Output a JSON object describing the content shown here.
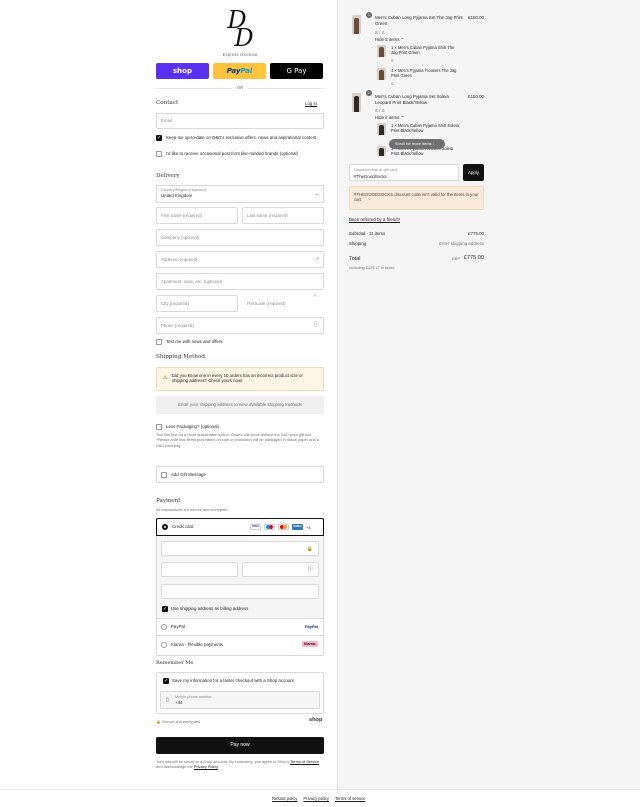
{
  "brand": {
    "logo_line1": "D",
    "logo_line2": "D"
  },
  "express": {
    "label": "Express checkout",
    "shop_label": "shop",
    "paypal_label_1": "Pay",
    "paypal_label_2": "Pal",
    "gpay_label": "G Pay",
    "or_label": "OR"
  },
  "contact": {
    "title": "Contact",
    "login_label": "Log in",
    "email_placeholder": "Email",
    "newsletter_label": "Keep me up-to-date on D&D's exclusive offers, news and aspirational content",
    "newsletter_checked": true,
    "post_label": "I'd like to receive occasional post from like-minded brands (optional)",
    "post_checked": false
  },
  "delivery": {
    "title": "Delivery",
    "country_label": "Country/Region (required)",
    "country_value": "United Kingdom",
    "first_name": "First name (required)",
    "last_name": "Last name (required)",
    "company": "Company (optional)",
    "address": "Address (required)",
    "apartment": "Apartment, suite, etc. (optional)",
    "city": "City (required)",
    "postcode": "Postcode (required)",
    "postcode_truncated": "P...",
    "phone": "Phone (required)",
    "text_news_label": "Text me with news and offers",
    "text_news_checked": false
  },
  "shipping": {
    "title": "Shipping Method",
    "notice": "Did you know one in every 10 orders has an incorrect product size or shipping address? Check yours now!",
    "placeholder": "Enter your shipping address to view available shipping methods",
    "less_packaging_label": "Less Packaging? (optional)",
    "less_packaging_note": "Tick this box for a more sustainable option. Orders will come without the D&D print gift box. *Please note that items purchased on sale or promotion will be packaged in tissue paper and a D&D bath bag.",
    "gift_message_label": "Add Gift Message"
  },
  "payment": {
    "title": "Payment",
    "subtitle": "All transactions are secure and encrypted.",
    "credit_card_label": "Credit card",
    "card_logos": [
      {
        "name": "VISA",
        "bg": "#ffffff",
        "fg": "#1a1f71"
      },
      {
        "name": "MC",
        "bg": "#ffffff",
        "fg": "#eb001b"
      },
      {
        "name": "MC2",
        "bg": "#ffffff",
        "fg": "#eb001b"
      },
      {
        "name": "AMEX",
        "bg": "#2e77bb",
        "fg": "#ffffff"
      }
    ],
    "more_cards": "+4",
    "billing_same_label": "Use shipping address as billing address",
    "billing_same_checked": true,
    "paypal_label": "PayPal",
    "paypal_logo": "PayPal",
    "klarna_label": "Klarna - Flexible payments",
    "klarna_logo": "Klarna."
  },
  "remember": {
    "title": "Remember Me",
    "save_label": "Save my information for a faster checkout with a Shop account",
    "save_checked": true,
    "mobile_label": "Mobile phone number",
    "mobile_value": "+44",
    "secure_label": "Secure and encrypted",
    "shop_logo": "shop"
  },
  "pay_now_label": "Pay now",
  "terms": {
    "text_1": "Your info will be saved to a Shop account. By continuing, you agree to Shop's",
    "terms_link": "Terms of Service",
    "text_2": "and acknowledge the",
    "privacy_link": "Privacy Policy",
    "text_3": "."
  },
  "footer": {
    "links": [
      "Refund policy",
      "Privacy policy",
      "Terms of service"
    ]
  },
  "order": {
    "items": [
      {
        "qty_badge": "1",
        "title": "Men's Cuban Long Pyjama Set The Jag Print Green",
        "variant": "S / S",
        "price": "£150.00",
        "toggle_label": "Hide 2 items ⌃",
        "sub_items": [
          {
            "title": "1 × Men's Cuban Pyjama Shirt The Jag Print Green",
            "variant": "S"
          },
          {
            "title": "1 × Men's Pyjama Trousers The Jag Print Green",
            "variant": "S"
          }
        ]
      },
      {
        "qty_badge": "1",
        "title": "Men's Cuban Long Pyjama Set Soleia Leopard Print Black/Yellow",
        "variant": "S / S",
        "price": "£150.00",
        "toggle_label": "Hide 2 items ⌃",
        "sub_items": [
          {
            "title": "1 × Men's Cuban Pyjama Shirt Soleia Print Black/Yellow",
            "variant": "S"
          },
          {
            "title": "1 × Men's Pyjama Trousers Soleia Print Black/Yellow",
            "variant": "S"
          }
        ]
      }
    ],
    "scroll_tooltip": "Scroll for more items ↓",
    "discount_placeholder": "Discount code or gift card",
    "discount_value": "#TheGoodSocks",
    "apply_label": "Apply",
    "discount_error": "#THEGOODSOCKS discount code isn't valid for the items in your cart",
    "referral_label": "Been referred by a friend?",
    "subtotal_label": "Subtotal · 11 items",
    "subtotal_value": "£775.00",
    "shipping_label": "Shipping",
    "shipping_value": "Enter shipping address",
    "total_label": "Total",
    "currency": "GBP",
    "total_value": "£775.00",
    "taxes_note": "Including £129.17 in taxes"
  }
}
